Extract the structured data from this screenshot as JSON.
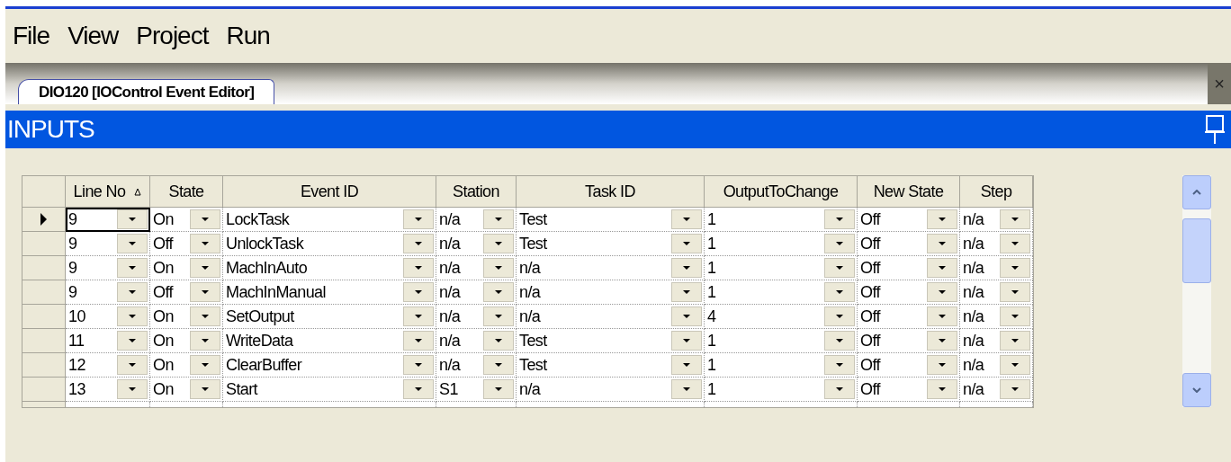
{
  "menu": [
    "File",
    "View",
    "Project",
    "Run"
  ],
  "tab": {
    "label": "DIO120 [IOControl Event Editor]",
    "close": "×"
  },
  "panel": {
    "title": "INPUTS"
  },
  "table": {
    "columns": [
      {
        "label": "Line No",
        "sorted": true
      },
      {
        "label": "State",
        "sorted": false
      },
      {
        "label": "Event ID",
        "sorted": false
      },
      {
        "label": "Station",
        "sorted": false
      },
      {
        "label": "Task ID",
        "sorted": false
      },
      {
        "label": "OutputToChange",
        "sorted": false
      },
      {
        "label": "New State",
        "sorted": false
      },
      {
        "label": "Step",
        "sorted": false
      }
    ],
    "rows": [
      {
        "selected": true,
        "cells": [
          "9",
          "On",
          "LockTask",
          "n/a",
          "Test",
          "1",
          "Off",
          "n/a"
        ]
      },
      {
        "selected": false,
        "cells": [
          "9",
          "Off",
          "UnlockTask",
          "n/a",
          "Test",
          "1",
          "Off",
          "n/a"
        ]
      },
      {
        "selected": false,
        "cells": [
          "9",
          "On",
          "MachInAuto",
          "n/a",
          "n/a",
          "1",
          "Off",
          "n/a"
        ]
      },
      {
        "selected": false,
        "cells": [
          "9",
          "Off",
          "MachInManual",
          "n/a",
          "n/a",
          "1",
          "Off",
          "n/a"
        ]
      },
      {
        "selected": false,
        "cells": [
          "10",
          "On",
          "SetOutput",
          "n/a",
          "n/a",
          "4",
          "Off",
          "n/a"
        ]
      },
      {
        "selected": false,
        "cells": [
          "11",
          "On",
          "WriteData",
          "n/a",
          "Test",
          "1",
          "Off",
          "n/a"
        ]
      },
      {
        "selected": false,
        "cells": [
          "12",
          "On",
          "ClearBuffer",
          "n/a",
          "Test",
          "1",
          "Off",
          "n/a"
        ]
      },
      {
        "selected": false,
        "cells": [
          "13",
          "On",
          "Start",
          "S1",
          "n/a",
          "1",
          "Off",
          "n/a"
        ]
      }
    ]
  }
}
